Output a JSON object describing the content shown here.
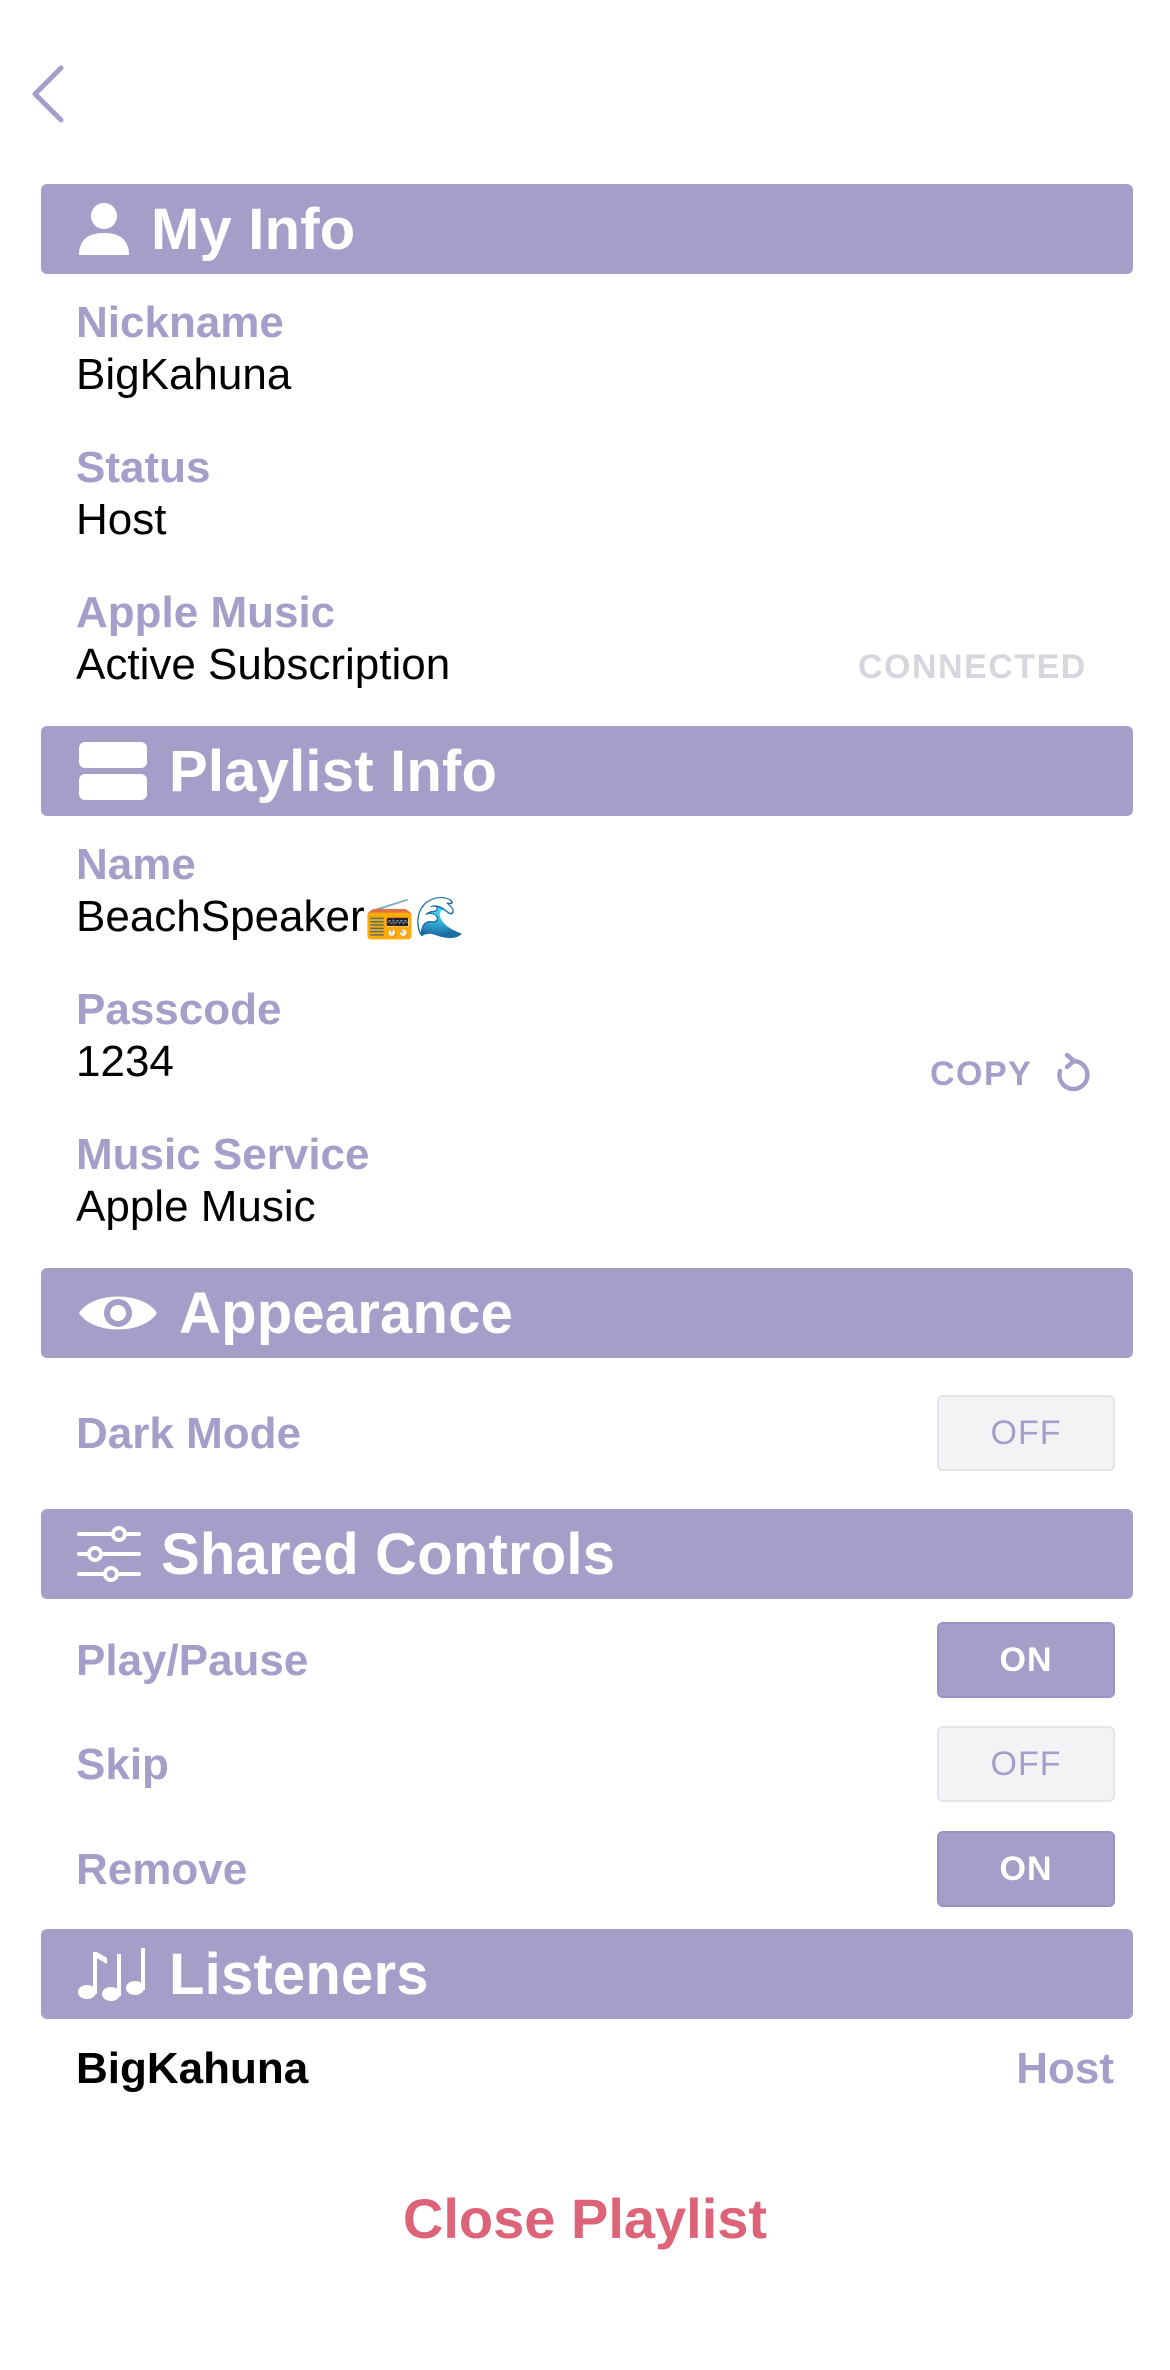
{
  "colors": {
    "accent": "#a39fc9",
    "text": "#000000",
    "danger": "#dd6478",
    "muted": "#d6d6dc"
  },
  "nav": {
    "back_icon": "chevron-left-icon"
  },
  "my_info": {
    "title": "My Info",
    "icon": "person-icon",
    "nickname_label": "Nickname",
    "nickname_value": "BigKahuna",
    "status_label": "Status",
    "status_value": "Host",
    "apple_music_label": "Apple Music",
    "apple_music_value": "Active Subscription",
    "apple_music_status": "CONNECTED"
  },
  "playlist_info": {
    "title": "Playlist Info",
    "icon": "stacked-rectangles-icon",
    "name_label": "Name",
    "name_value": "BeachSpeaker",
    "name_emojis": "📻🌊",
    "passcode_label": "Passcode",
    "passcode_value": "1234",
    "copy_label": "COPY",
    "refresh_icon": "refresh-icon",
    "music_service_label": "Music Service",
    "music_service_value": "Apple Music"
  },
  "appearance": {
    "title": "Appearance",
    "icon": "eye-icon",
    "dark_mode_label": "Dark Mode",
    "dark_mode_state": "OFF"
  },
  "shared_controls": {
    "title": "Shared Controls",
    "icon": "sliders-icon",
    "items": [
      {
        "label": "Play/Pause",
        "state": "ON"
      },
      {
        "label": "Skip",
        "state": "OFF"
      },
      {
        "label": "Remove",
        "state": "ON"
      }
    ]
  },
  "listeners": {
    "title": "Listeners",
    "icon": "music-notes-icon",
    "items": [
      {
        "name": "BigKahuna",
        "role": "Host"
      }
    ]
  },
  "close_label": "Close Playlist"
}
